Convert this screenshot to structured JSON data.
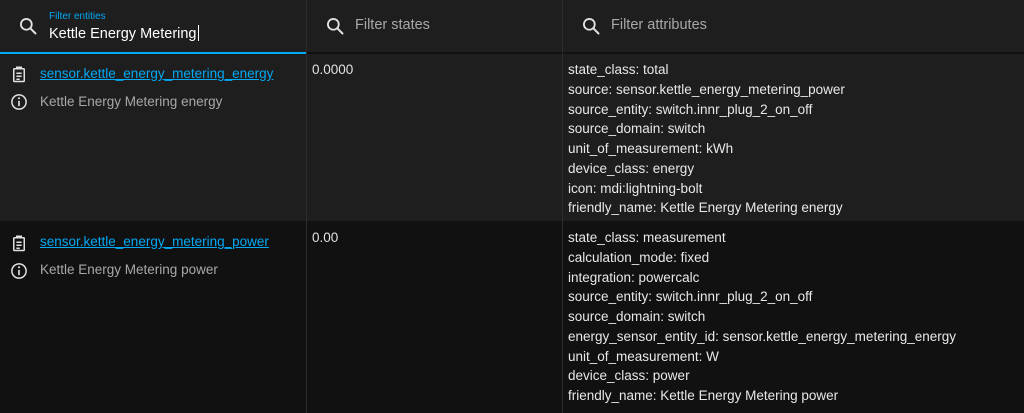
{
  "header": {
    "entities_filter": {
      "label": "Filter entities",
      "value": "Kettle Energy Metering"
    },
    "states_filter": {
      "placeholder": "Filter states"
    },
    "attributes_filter": {
      "placeholder": "Filter attributes"
    }
  },
  "rows": [
    {
      "entity_id": "sensor.kettle_energy_metering_energy",
      "friendly_name": "Kettle Energy Metering energy",
      "state": "0.0000",
      "attributes": [
        "state_class: total",
        "source: sensor.kettle_energy_metering_power",
        "source_entity: switch.innr_plug_2_on_off",
        "source_domain: switch",
        "unit_of_measurement: kWh",
        "device_class: energy",
        "icon: mdi:lightning-bolt",
        "friendly_name: Kettle Energy Metering energy"
      ]
    },
    {
      "entity_id": "sensor.kettle_energy_metering_power",
      "friendly_name": "Kettle Energy Metering power",
      "state": "0.00",
      "attributes": [
        "state_class: measurement",
        "calculation_mode: fixed",
        "integration: powercalc",
        "source_entity: switch.innr_plug_2_on_off",
        "source_domain: switch",
        "energy_sensor_entity_id: sensor.kettle_energy_metering_energy",
        "unit_of_measurement: W",
        "device_class: power",
        "friendly_name: Kettle Energy Metering power"
      ]
    }
  ],
  "colors": {
    "accent": "#03a9f4",
    "header_bg": "#1e1e1e",
    "row_alt_bg": "#1e1e1e",
    "page_bg": "#111111"
  },
  "icons": {
    "filter": "search-icon",
    "copy": "clipboard-icon",
    "info": "info-icon"
  }
}
